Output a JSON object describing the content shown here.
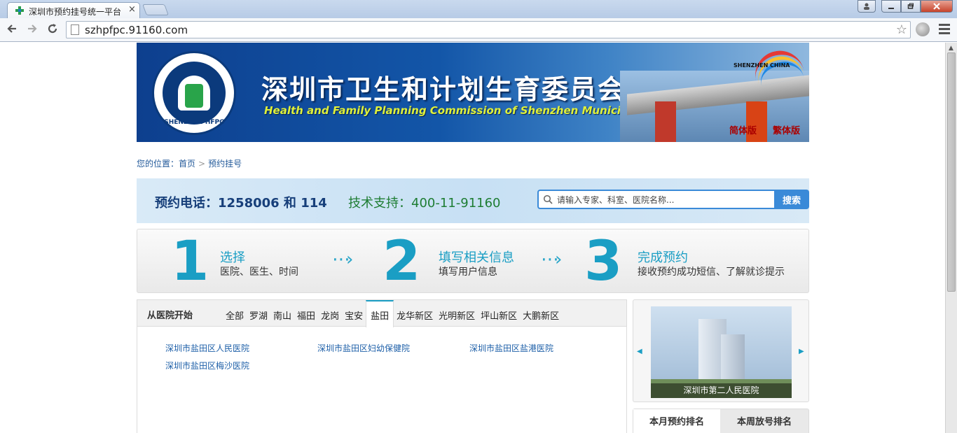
{
  "browser": {
    "tab_title": "深圳市预约挂号统一平台",
    "tab_close": "×",
    "url": "szhpfpc.91160.com"
  },
  "banner": {
    "title": "深圳市卫生和计划生育委员会",
    "subtitle": "Health and Family Planning Commission of Shenzhen Municipality",
    "logo_text": "SHENZHEN HFPC",
    "city_logo_text": "SHENZHEN CHINA",
    "lang_simplified": "简体版",
    "lang_traditional": "繁体版"
  },
  "breadcrumb": {
    "prefix": "您的位置：",
    "home": "首页",
    "separator": ">",
    "current": "预约挂号"
  },
  "hotline": {
    "phone": "预约电话：1258006 和 114",
    "support": "技术支持：400-11-91160"
  },
  "search": {
    "placeholder": "请输入专家、科室、医院名称...",
    "button": "搜索"
  },
  "steps": [
    {
      "num": "1",
      "title": "选择",
      "desc": "医院、医生、时间"
    },
    {
      "num": "2",
      "title": "填写相关信息",
      "desc": "填写用户信息"
    },
    {
      "num": "3",
      "title": "完成预约",
      "desc": "接收预约成功短信、了解就诊提示"
    }
  ],
  "region": {
    "label": "从医院开始",
    "tabs": [
      "全部",
      "罗湖",
      "南山",
      "福田",
      "龙岗",
      "宝安",
      "盐田",
      "龙华新区",
      "光明新区",
      "坪山新区",
      "大鹏新区"
    ],
    "active_tab": "盐田",
    "hospitals": [
      "深圳市盐田区人民医院",
      "深圳市盐田区妇幼保健院",
      "深圳市盐田区盐港医院",
      "深圳市盐田区梅沙医院"
    ]
  },
  "slider": {
    "caption": "深圳市第二人民医院"
  },
  "ranking": {
    "tab_month": "本月预约排名",
    "tab_week": "本周放号排名"
  },
  "colors": {
    "accent": "#1a9ec4",
    "link": "#1d5fa8",
    "search_blue": "#3a8ad8"
  }
}
